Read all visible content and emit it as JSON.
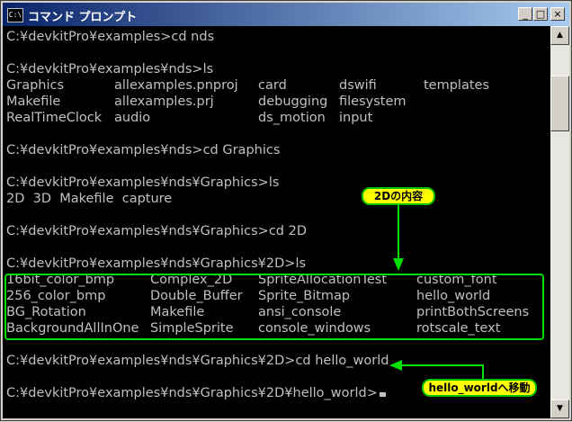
{
  "window": {
    "title": "コマンド プロンプト",
    "icon_text": "C:\\",
    "buttons": {
      "minimize": "_",
      "maximize": "□",
      "close": "×"
    }
  },
  "console": {
    "lines": [
      "C:¥devkitPro¥examples>cd nds",
      "",
      "C:¥devkitPro¥examples¥nds>ls",
      "",
      "",
      "",
      "",
      "C:¥devkitPro¥examples¥nds>cd Graphics",
      "",
      "C:¥devkitPro¥examples¥nds¥Graphics>ls",
      "2D  3D  Makefile  capture",
      "",
      "C:¥devkitPro¥examples¥nds¥Graphics>cd 2D",
      "",
      "C:¥devkitPro¥examples¥nds¥Graphics¥2D>ls",
      "",
      "",
      "",
      "",
      "",
      "C:¥devkitPro¥examples¥nds¥Graphics¥2D>cd hello_world",
      "",
      "C:¥devkitPro¥examples¥nds¥Graphics¥2D¥hello_world>"
    ],
    "nds_listing": [
      [
        "Graphics",
        "allexamples.pnproj",
        "card",
        "dswifi",
        "templates"
      ],
      [
        "Makefile",
        "allexamples.prj",
        "debugging",
        "filesystem",
        ""
      ],
      [
        "RealTimeClock",
        "audio",
        "ds_motion",
        "input",
        ""
      ]
    ],
    "twod_listing": [
      [
        "16bit_color_bmp",
        "Complex_2D",
        "SpriteAllocationTest",
        "custom_font"
      ],
      [
        "256_color_bmp",
        "Double_Buffer",
        "Sprite_Bitmap",
        "hello_world"
      ],
      [
        "BG_Rotation",
        "Makefile",
        "ansi_console",
        "printBothScreens"
      ],
      [
        "BackgroundAllInOne",
        "SimpleSprite",
        "console_windows",
        "rotscale_text"
      ]
    ]
  },
  "annotations": {
    "callout_2d": "2Dの内容",
    "callout_hello": "hello_worldへ移動",
    "accent_color": "#ffff00",
    "border_color": "#00e000"
  },
  "scrollbar": {
    "up": "▲",
    "down": "▼"
  }
}
